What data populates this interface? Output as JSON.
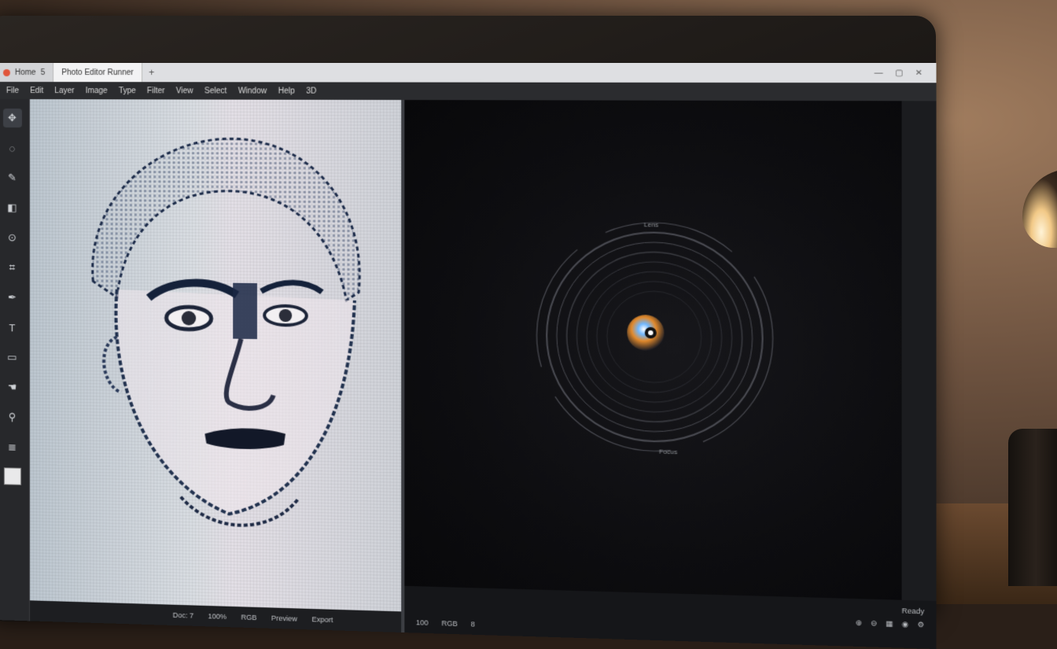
{
  "window": {
    "tabs": [
      {
        "label": "Home",
        "extra": "5"
      },
      {
        "label": "Photo Editor Runner"
      }
    ],
    "new_tab_glyph": "+",
    "controls": [
      "—",
      "▢",
      "✕"
    ]
  },
  "menu": [
    "File",
    "Edit",
    "Layer",
    "Image",
    "Type",
    "Filter",
    "View",
    "Select",
    "Window",
    "Help",
    "3D"
  ],
  "toolbar": {
    "tools": [
      {
        "icon": "move-icon",
        "glyph": "✥"
      },
      {
        "icon": "lasso-icon",
        "glyph": "◌"
      },
      {
        "icon": "brush-icon",
        "glyph": "✎"
      },
      {
        "icon": "eraser-icon",
        "glyph": "◧"
      },
      {
        "icon": "stamp-icon",
        "glyph": "⊙"
      },
      {
        "icon": "crop-icon",
        "glyph": "⌗"
      },
      {
        "icon": "pen-icon",
        "glyph": "✒"
      },
      {
        "icon": "text-icon",
        "glyph": "T"
      },
      {
        "icon": "shape-icon",
        "glyph": "▭"
      },
      {
        "icon": "hand-icon",
        "glyph": "☚"
      },
      {
        "icon": "zoom-icon",
        "glyph": "⚲"
      },
      {
        "icon": "layers-icon",
        "glyph": "≣"
      }
    ]
  },
  "left_status": [
    "Doc: 7",
    "100%",
    "RGB",
    "Preview",
    "Export"
  ],
  "viewport": {
    "lens_top_label": "Lens",
    "lens_bottom_label": "Focus"
  },
  "viewport_status": {
    "left": [
      "100",
      "RGB",
      "8"
    ],
    "right_top": "Ready",
    "icons": [
      "zoom-in-icon",
      "zoom-out-icon",
      "grid-icon",
      "camera-icon",
      "settings-icon"
    ]
  },
  "colors": {
    "accent": "#e0553a",
    "canvas_bg": "#d9dde2",
    "viewport_bg": "#0d0d10"
  }
}
